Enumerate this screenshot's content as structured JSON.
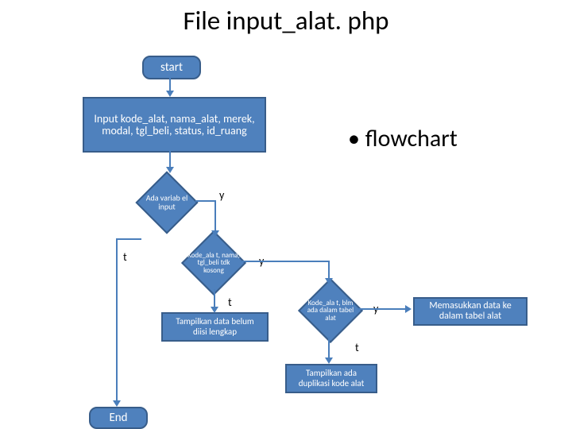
{
  "title": "File input_alat. php",
  "bullet": "flowchart",
  "start": "start",
  "end": "End",
  "input_box": "Input  kode_alat, nama_alat, merek, modal, tgl_beli, status, id_ruang",
  "dec1": "Ada variab el input",
  "dec2": "Kode_ala t, nama, tgl_beli  tdk  kosong",
  "dec3": "Kode_ala t, blm ada dalam tabel alat",
  "msg_incomplete_top": "Tampilkan data belum",
  "msg_incomplete_bot": "diisi lengkap",
  "msg_dup_top": "Tampilkan ada",
  "msg_dup_bot": "duplikasi kode alat",
  "msg_insert_top": "Memasukkan data ke",
  "msg_insert_bot": "dalam tabel alat",
  "labels": {
    "t": "t",
    "y": "y"
  }
}
